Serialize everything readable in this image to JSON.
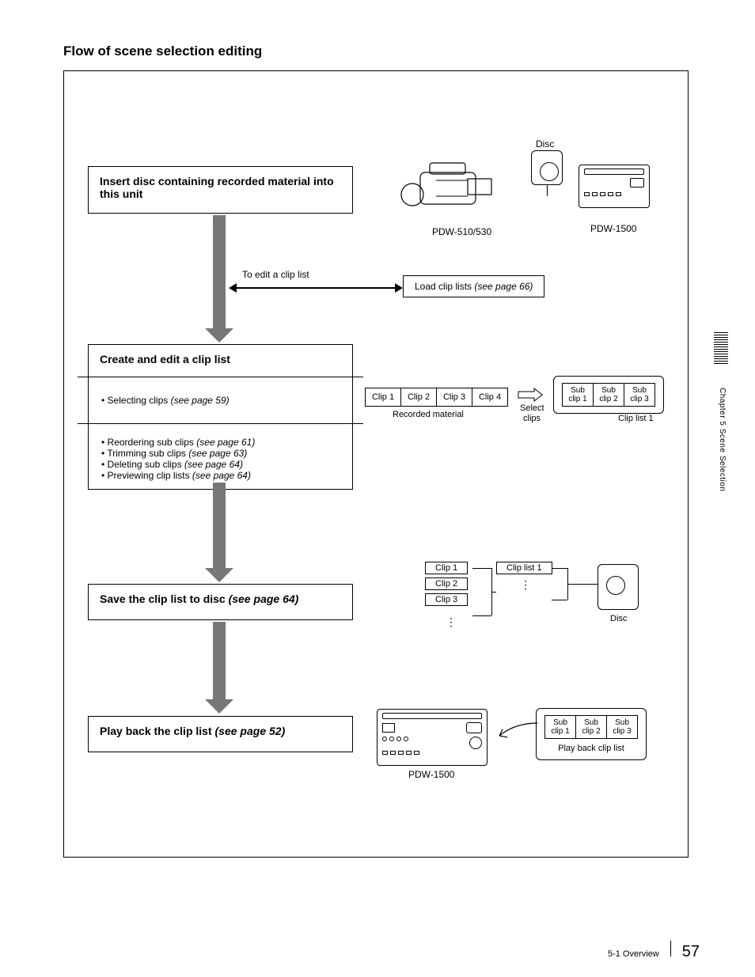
{
  "heading": "Flow of scene selection editing",
  "step1": {
    "title": "Insert disc containing recorded material into this unit"
  },
  "devices": {
    "camera": "PDW-510/530",
    "deck": "PDW-1500",
    "disc": "Disc"
  },
  "edit_label": "To edit a clip list",
  "load_label": "Load clip lists ",
  "load_ref": "(see page 66)",
  "step2": {
    "title": "Create and edit a clip list",
    "sel": "Selecting clips ",
    "sel_ref": "(see page 59)",
    "b1": "Reordering sub clips ",
    "b1r": "(see page 61)",
    "b2": "Trimming sub clips ",
    "b2r": "(see page 63)",
    "b3": "Deleting sub clips ",
    "b3r": "(see page 64)",
    "b4": "Previewing clip lists ",
    "b4r": "(see page 64)"
  },
  "clips": [
    "Clip 1",
    "Clip 2",
    "Clip 3",
    "Clip 4"
  ],
  "recorded_label": "Recorded material",
  "select_label_1": "Select",
  "select_label_2": "clips",
  "subclips": [
    "Sub clip 1",
    "Sub clip 2",
    "Sub clip 3"
  ],
  "cliplist1": "Clip list 1",
  "step3": {
    "title_a": "Save the clip list to disc ",
    "title_b": "(see page 64)"
  },
  "save_clips": [
    "Clip 1",
    "Clip 2",
    "Clip 3"
  ],
  "save_list": "Clip list 1",
  "save_disc": "Disc",
  "step4": {
    "title_a": "Play back the clip list ",
    "title_b": "(see page 52)"
  },
  "playback_label": "Play back clip list",
  "pdw1500": "PDW-1500",
  "side_chapter": "Chapter 5   Scene Selection",
  "footer_label": "5-1 Overview",
  "page_num": "57"
}
